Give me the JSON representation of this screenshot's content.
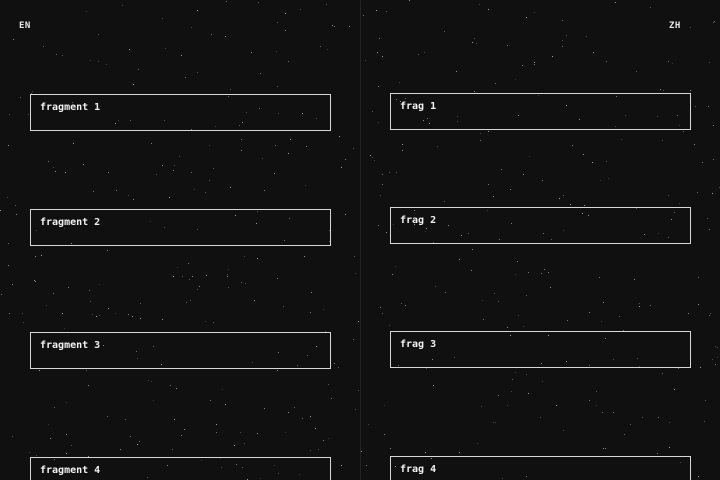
{
  "header": {
    "left_language": "EN",
    "right_language": "ZH"
  },
  "columns": {
    "left": {
      "fragments": [
        "fragment 1",
        "fragment 2",
        "fragment 3",
        "fragment 4"
      ]
    },
    "right": {
      "fragments": [
        "frag 1",
        "frag 2",
        "frag 3",
        "frag 4"
      ]
    }
  },
  "colors": {
    "background": "#101011",
    "box_border": "#d8d8d8",
    "text": "#f2f2f2",
    "star": "#bfbfbf"
  }
}
